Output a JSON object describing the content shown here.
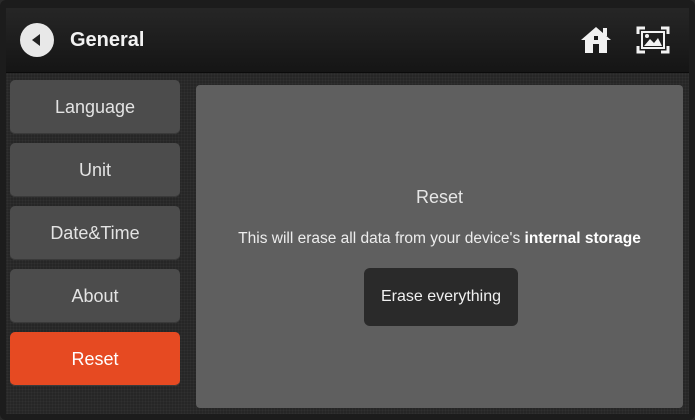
{
  "header": {
    "title": "General",
    "back_icon": "back-arrow-icon",
    "right_icons": [
      "home-icon",
      "screenshot-icon"
    ]
  },
  "sidebar": {
    "items": [
      {
        "label": "Language"
      },
      {
        "label": "Unit"
      },
      {
        "label": "Date&Time"
      },
      {
        "label": "About"
      },
      {
        "label": "Reset",
        "active": true
      }
    ]
  },
  "panel": {
    "title": "Reset",
    "description_prefix": "This will erase all data from your device's ",
    "description_bold": "internal storage",
    "button_label": "Erase everything"
  },
  "colors": {
    "accent": "#e64a22",
    "sidebar_item": "#4c4c4c",
    "panel": "#5f5f5f",
    "button": "#2a2a2a"
  }
}
